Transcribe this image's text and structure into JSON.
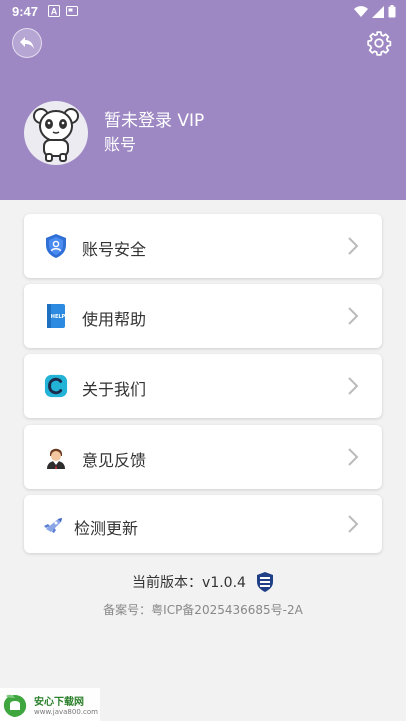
{
  "status_bar": {
    "time": "9:47"
  },
  "header": {
    "back_icon": "back-arrow-icon",
    "settings_icon": "gear-icon",
    "user_name": "暂未登录  VIP",
    "account_label": "账号",
    "bg_color": "#9e88c4"
  },
  "menu": [
    {
      "label": "账号安全",
      "icon": "shield-user-icon"
    },
    {
      "label": "使用帮助",
      "icon": "help-book-icon"
    },
    {
      "label": "关于我们",
      "icon": "about-logo-icon"
    },
    {
      "label": "意见反馈",
      "icon": "support-person-icon"
    },
    {
      "label": "检测更新",
      "icon": "update-rocket-icon"
    }
  ],
  "footer": {
    "version": "当前版本：v1.0.4",
    "record": "备案号：粤ICP备2025436685号-2A"
  },
  "watermark": {
    "title": "安心下载网",
    "url": "www.java800.com"
  }
}
